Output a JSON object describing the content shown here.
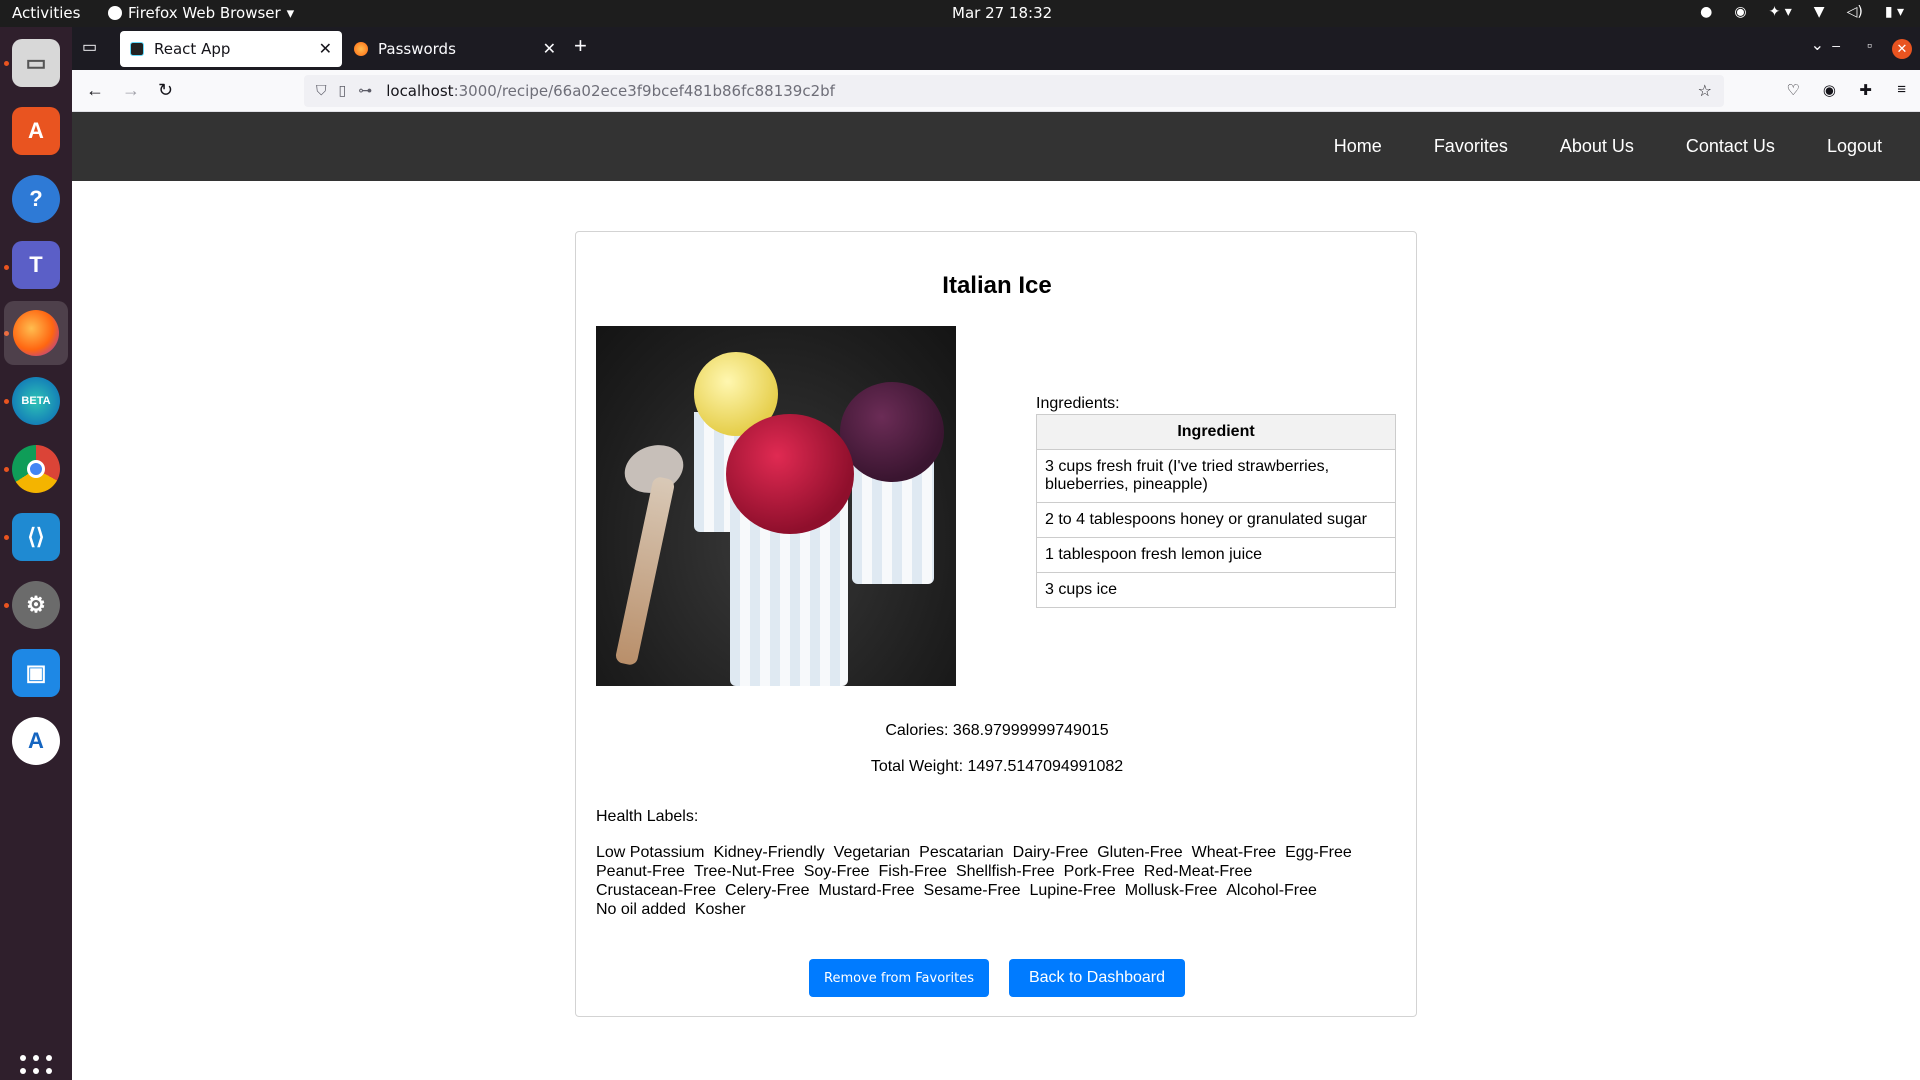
{
  "system": {
    "activities": "Activities",
    "app_name": "Firefox Web Browser",
    "clock": "Mar 27  18:32"
  },
  "browser": {
    "tabs": [
      {
        "label": "React App",
        "active": true
      },
      {
        "label": "Passwords",
        "active": false
      }
    ],
    "url_host": "localhost",
    "url_path": ":3000/recipe/66a02ece3f9bcef481b86fc88139c2bf"
  },
  "site_nav": {
    "links": [
      "Home",
      "Favorites",
      "About Us",
      "Contact Us",
      "Logout"
    ]
  },
  "recipe": {
    "title": "Italian Ice",
    "ingredients_caption": "Ingredients:",
    "ingredients_header": "Ingredient",
    "ingredients": [
      "3 cups fresh fruit (I've tried strawberries, blueberries, pineapple)",
      "2 to 4 tablespoons honey or granulated sugar",
      "1 tablespoon fresh lemon juice",
      "3 cups ice"
    ],
    "calories": "Calories: 368.97999999749015",
    "total_weight": "Total Weight: 1497.5147094991082",
    "health_title": "Health Labels:",
    "health_labels": [
      "Low Potassium",
      "Kidney-Friendly",
      "Vegetarian",
      "Pescatarian",
      "Dairy-Free",
      "Gluten-Free",
      "Wheat-Free",
      "Egg-Free",
      "Peanut-Free",
      "Tree-Nut-Free",
      "Soy-Free",
      "Fish-Free",
      "Shellfish-Free",
      "Pork-Free",
      "Red-Meat-Free",
      "Crustacean-Free",
      "Celery-Free",
      "Mustard-Free",
      "Sesame-Free",
      "Lupine-Free",
      "Mollusk-Free",
      "Alcohol-Free",
      "No oil added",
      "Kosher"
    ],
    "remove_button": "Remove from Favorites",
    "back_button": "Back to Dashboard"
  },
  "colors": {
    "nav_bg": "#333333",
    "button_blue": "#007bff",
    "dock_bg": "#2f1f2c"
  }
}
